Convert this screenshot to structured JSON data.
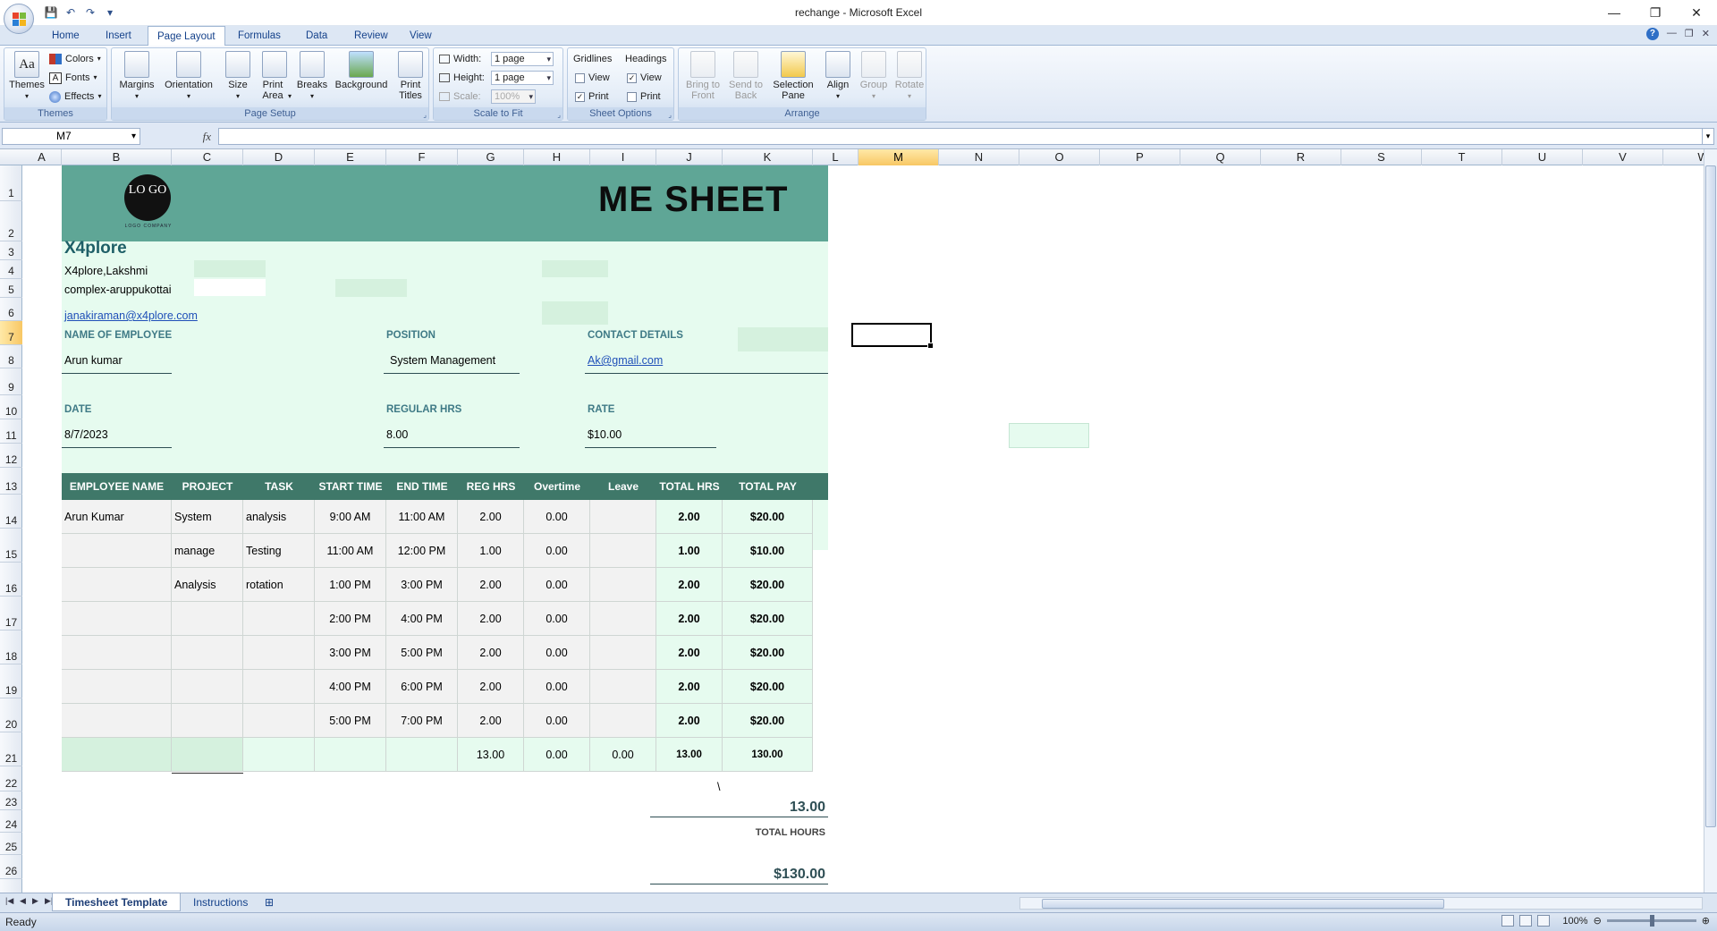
{
  "window": {
    "title": "rechange - Microsoft Excel",
    "min": "—",
    "max": "❐",
    "close": "✕"
  },
  "qat": {
    "save": "💾",
    "undo": "↶",
    "redo": "↷",
    "more": "▾"
  },
  "tabs": [
    "Home",
    "Insert",
    "Page Layout",
    "Formulas",
    "Data",
    "Review",
    "View"
  ],
  "doc_controls": {
    "help": "?",
    "min": "—",
    "restore": "❐",
    "close": "✕"
  },
  "ribbon": {
    "themes": {
      "themes": "Themes",
      "colors": "Colors",
      "fonts": "Fonts",
      "effects": "Effects",
      "group": "Themes"
    },
    "page_setup": {
      "margins": "Margins",
      "orientation": "Orientation",
      "size": "Size",
      "print_area": "Print Area",
      "breaks": "Breaks",
      "background": "Background",
      "print_titles": "Print Titles",
      "group": "Page Setup"
    },
    "scale": {
      "width_label": "Width:",
      "width_value": "1 page",
      "height_label": "Height:",
      "height_value": "1 page",
      "scale_label": "Scale:",
      "scale_value": "100%",
      "group": "Scale to Fit"
    },
    "sheet_options": {
      "gridlines": "Gridlines",
      "headings": "Headings",
      "view": "View",
      "print": "Print",
      "group": "Sheet Options"
    },
    "arrange": {
      "bring": "Bring to Front",
      "send": "Send to Back",
      "selection": "Selection Pane",
      "align": "Align",
      "group_btn": "Group",
      "rotate": "Rotate",
      "group": "Arrange"
    }
  },
  "formula_bar": {
    "name_box": "M7",
    "fx": "fx",
    "value": ""
  },
  "columns": [
    "A",
    "B",
    "C",
    "D",
    "E",
    "F",
    "G",
    "H",
    "I",
    "J",
    "K",
    "L",
    "M",
    "N",
    "O",
    "P",
    "Q",
    "R",
    "S",
    "T",
    "U",
    "V",
    "W"
  ],
  "rows": [
    "1",
    "2",
    "3",
    "4",
    "5",
    "6",
    "7",
    "8",
    "9",
    "10",
    "11",
    "12",
    "13",
    "14",
    "15",
    "16",
    "17",
    "18",
    "19",
    "20",
    "21",
    "22",
    "23",
    "24",
    "25",
    "26"
  ],
  "sheet": {
    "logo_text": "LO GO",
    "logo_caption": "LOGO COMPANY",
    "banner_title": "ME SHEET",
    "company": "X4plore",
    "address1": "X4plore,Lakshmi",
    "address2": "complex-aruppukottai",
    "email": "janakiraman@x4plore.com",
    "name_label": "NAME OF EMPLOYEE",
    "name_value": "Arun kumar",
    "position_label": "POSITION",
    "position_value": "System Management",
    "contact_label": "CONTACT DETAILS",
    "contact_value": "Ak@gmail.com",
    "date_label": "DATE",
    "date_value": "8/7/2023",
    "regular_label": "REGULAR HRS",
    "regular_value": "8.00",
    "rate_label": "RATE",
    "rate_value": "$10.00"
  },
  "table": {
    "headers": [
      "EMPLOYEE NAME",
      "PROJECT",
      "TASK",
      "START TIME",
      "END TIME",
      "REG HRS",
      "Overtime",
      "Leave",
      "TOTAL HRS",
      "TOTAL PAY"
    ],
    "rows": [
      [
        "Arun Kumar",
        "System",
        "analysis",
        "9:00 AM",
        "11:00 AM",
        "2.00",
        "0.00",
        "",
        "2.00",
        "$20.00"
      ],
      [
        "",
        "manage",
        "Testing",
        "11:00 AM",
        "12:00 PM",
        "1.00",
        "0.00",
        "",
        "1.00",
        "$10.00"
      ],
      [
        "",
        "Analysis",
        "rotation",
        "1:00 PM",
        "3:00 PM",
        "2.00",
        "0.00",
        "",
        "2.00",
        "$20.00"
      ],
      [
        "",
        "",
        "",
        "2:00 PM",
        "4:00 PM",
        "2.00",
        "0.00",
        "",
        "2.00",
        "$20.00"
      ],
      [
        "",
        "",
        "",
        "3:00 PM",
        "5:00 PM",
        "2.00",
        "0.00",
        "",
        "2.00",
        "$20.00"
      ],
      [
        "",
        "",
        "",
        "4:00 PM",
        "6:00 PM",
        "2.00",
        "0.00",
        "",
        "2.00",
        "$20.00"
      ],
      [
        "",
        "",
        "",
        "5:00 PM",
        "7:00 PM",
        "2.00",
        "0.00",
        "",
        "2.00",
        "$20.00"
      ],
      [
        "",
        "",
        "",
        "",
        "",
        "13.00",
        "0.00",
        "0.00",
        "13.00",
        "130.00"
      ]
    ]
  },
  "summary": {
    "backslash": "\\",
    "total_hours_value": "13.00",
    "total_hours_label": "TOTAL HOURS",
    "total_pay_value": "$130.00"
  },
  "sheet_tabs": [
    "Timesheet Template",
    "Instructions"
  ],
  "status": {
    "text": "Ready",
    "zoom": "100%"
  }
}
